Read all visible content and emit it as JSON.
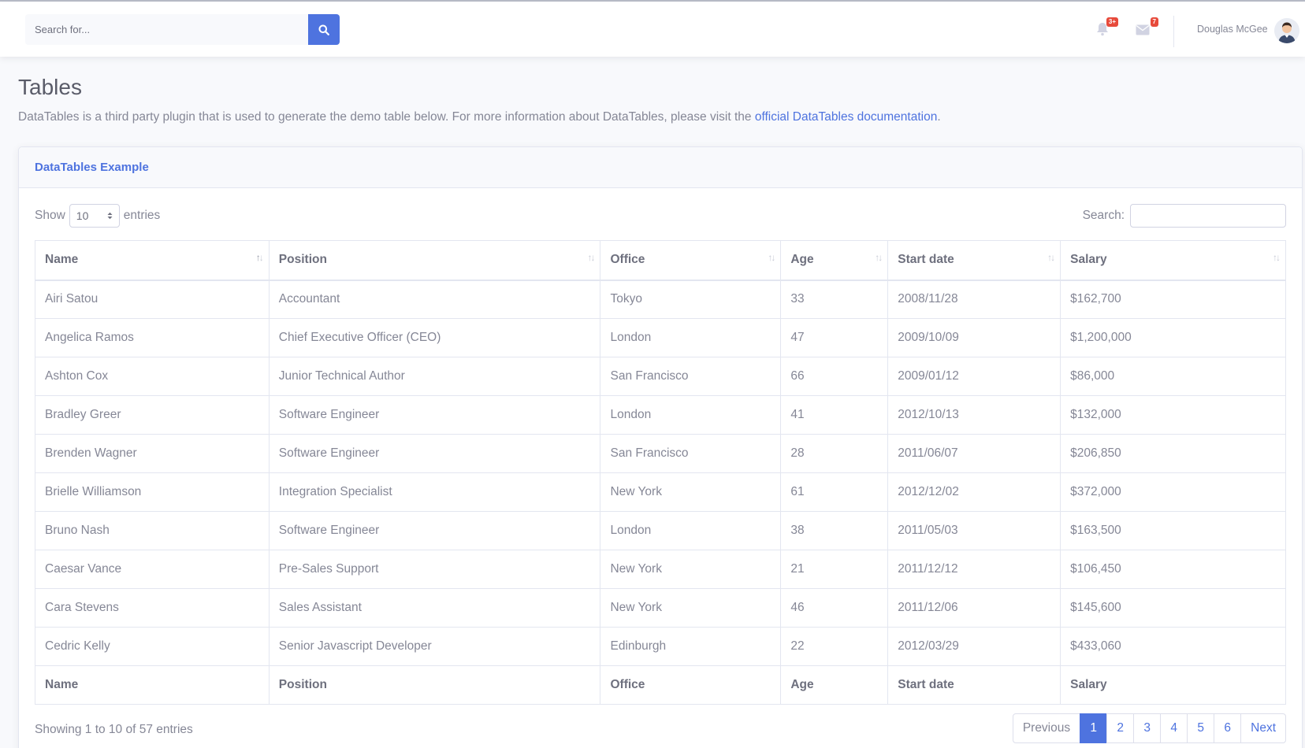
{
  "topbar": {
    "search_placeholder": "Search for...",
    "alerts_badge": "3+",
    "messages_badge": "7",
    "user_name": "Douglas McGee"
  },
  "page": {
    "title": "Tables",
    "description_prefix": "DataTables is a third party plugin that is used to generate the demo table below. For more information about DataTables, please visit the ",
    "description_link": "official DataTables documentation",
    "description_suffix": "."
  },
  "card": {
    "title": "DataTables Example",
    "show_label": "Show",
    "entries_label": "entries",
    "page_length": "10",
    "search_label": "Search:"
  },
  "table": {
    "columns": [
      "Name",
      "Position",
      "Office",
      "Age",
      "Start date",
      "Salary"
    ],
    "rows": [
      [
        "Airi Satou",
        "Accountant",
        "Tokyo",
        "33",
        "2008/11/28",
        "$162,700"
      ],
      [
        "Angelica Ramos",
        "Chief Executive Officer (CEO)",
        "London",
        "47",
        "2009/10/09",
        "$1,200,000"
      ],
      [
        "Ashton Cox",
        "Junior Technical Author",
        "San Francisco",
        "66",
        "2009/01/12",
        "$86,000"
      ],
      [
        "Bradley Greer",
        "Software Engineer",
        "London",
        "41",
        "2012/10/13",
        "$132,000"
      ],
      [
        "Brenden Wagner",
        "Software Engineer",
        "San Francisco",
        "28",
        "2011/06/07",
        "$206,850"
      ],
      [
        "Brielle Williamson",
        "Integration Specialist",
        "New York",
        "61",
        "2012/12/02",
        "$372,000"
      ],
      [
        "Bruno Nash",
        "Software Engineer",
        "London",
        "38",
        "2011/05/03",
        "$163,500"
      ],
      [
        "Caesar Vance",
        "Pre-Sales Support",
        "New York",
        "21",
        "2011/12/12",
        "$106,450"
      ],
      [
        "Cara Stevens",
        "Sales Assistant",
        "New York",
        "46",
        "2011/12/06",
        "$145,600"
      ],
      [
        "Cedric Kelly",
        "Senior Javascript Developer",
        "Edinburgh",
        "22",
        "2012/03/29",
        "$433,060"
      ]
    ]
  },
  "footer": {
    "info": "Showing 1 to 10 of 57 entries",
    "previous": "Previous",
    "next": "Next",
    "pages": [
      "1",
      "2",
      "3",
      "4",
      "5",
      "6"
    ],
    "active_page": "1"
  },
  "colors": {
    "primary": "#4e73df",
    "badge": "#e74a3b",
    "text": "#858796"
  }
}
